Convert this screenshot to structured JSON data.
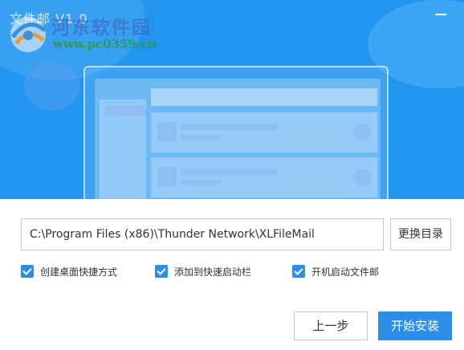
{
  "window": {
    "title": "文件邮 V1.0",
    "close_symbol": "—"
  },
  "watermark": {
    "site_name": "河东软件园",
    "url": "www.pc0359.cn"
  },
  "install": {
    "path_value": "C:\\Program Files (x86)\\Thunder Network\\XLFileMail",
    "browse_label": "更换目录"
  },
  "options": [
    {
      "label": "创建桌面快捷方式",
      "checked": true
    },
    {
      "label": "添加到快速启动栏",
      "checked": true
    },
    {
      "label": "开机启动文件邮",
      "checked": true
    }
  ],
  "buttons": {
    "prev_label": "上一步",
    "install_label": "开始安装"
  },
  "colors": {
    "banner": "#2196F0",
    "accent": "#2b8fe8"
  },
  "icons": {
    "close": "minimize-dash-icon",
    "checkbox": "checkmark-icon",
    "logo": "watermark-logo-icon"
  }
}
